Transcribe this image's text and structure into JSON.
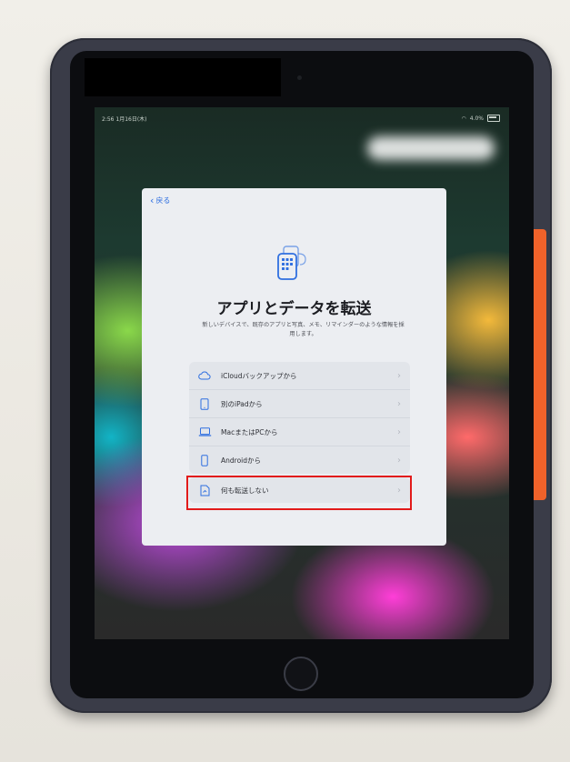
{
  "status_bar": {
    "time_date": "2:56 1月16日(木)",
    "battery": "4.0%"
  },
  "dialog": {
    "back_label": "戻る",
    "title": "アプリとデータを転送",
    "subtitle": "新しいデバイスで、既存のアプリと写真、メモ、リマインダーのような情報を採用します。",
    "options": [
      {
        "icon": "cloud-icon",
        "label": "iCloudバックアップから"
      },
      {
        "icon": "ipad-icon",
        "label": "別のiPadから"
      },
      {
        "icon": "laptop-icon",
        "label": "MacまたはPCから"
      },
      {
        "icon": "phone-icon",
        "label": "Androidから"
      }
    ],
    "none_option": {
      "icon": "document-icon",
      "label": "何も転送しない"
    }
  },
  "colors": {
    "accent": "#2f6fe0",
    "highlight": "#e21a1a",
    "case": "#3a3c48",
    "side_button": "#f0622a"
  }
}
